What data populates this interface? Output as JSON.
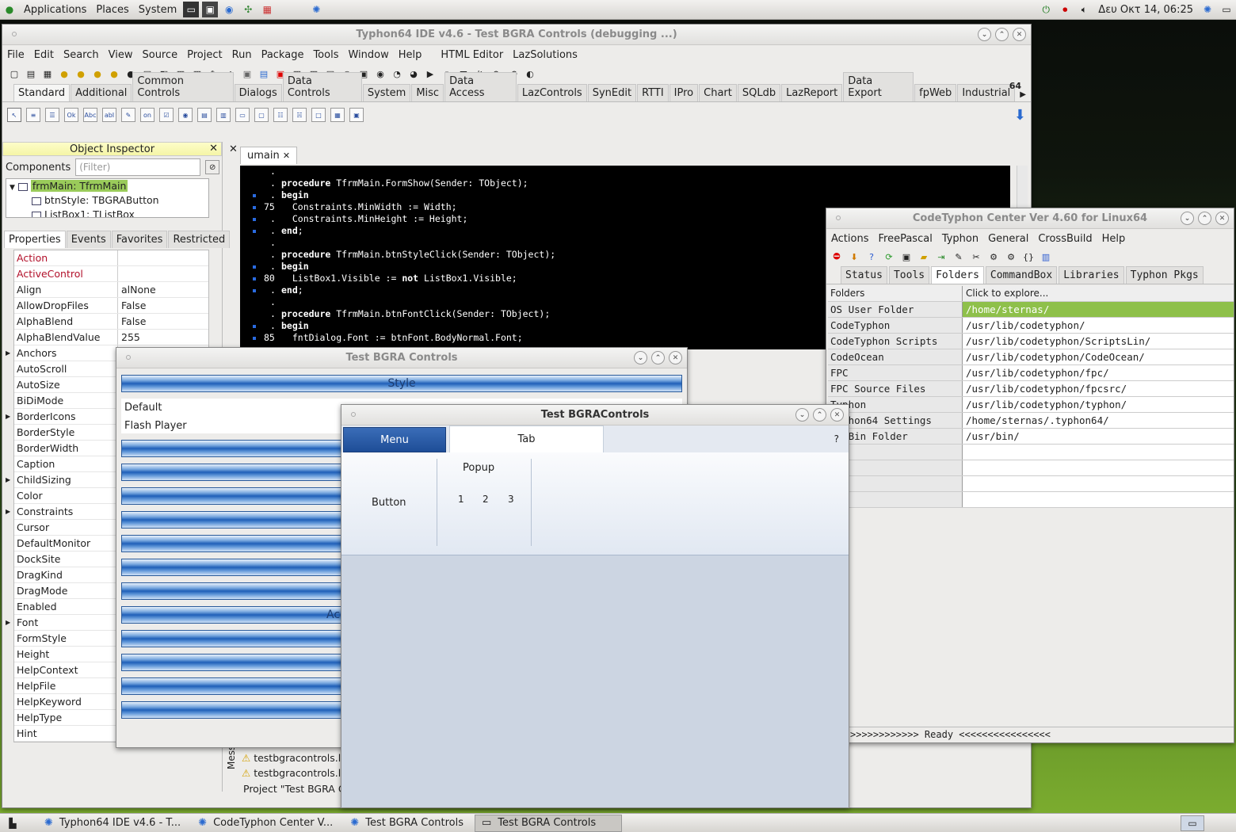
{
  "top_panel": {
    "menus": [
      "Applications",
      "Places",
      "System"
    ],
    "clock": "Δευ Οκτ 14, 06:25"
  },
  "ide": {
    "title": "Typhon64 IDE v4.6 - Test BGRA Controls (debugging ...)",
    "menu": [
      "File",
      "Edit",
      "Search",
      "View",
      "Source",
      "Project",
      "Run",
      "Package",
      "Tools",
      "Window",
      "Help",
      "HTML Editor",
      "LazSolutions"
    ],
    "palette_tabs": [
      "Standard",
      "Additional",
      "Common Controls",
      "Dialogs",
      "Data Controls",
      "System",
      "Misc",
      "Data Access",
      "LazControls",
      "SynEdit",
      "RTTI",
      "IPro",
      "Chart",
      "SQLdb",
      "LazReport",
      "Data Export",
      "fpWeb",
      "Industrial"
    ],
    "palette_number": "64",
    "palette_labels": {
      "ok": "Ok",
      "abc": "Abc",
      "abi": "abI",
      "on": "on"
    },
    "editor_tab": "umain",
    "code": [
      {
        "gut": ".",
        "num": "",
        "text": ""
      },
      {
        "gut": ".",
        "num": "",
        "text": "procedure TfrmMain.FormShow(Sender: TObject);"
      },
      {
        "gut": "•.",
        "num": "",
        "text": "begin"
      },
      {
        "gut": "•",
        "num": "75",
        "text": "  Constraints.MinWidth := Width;"
      },
      {
        "gut": "•.",
        "num": "",
        "text": "  Constraints.MinHeight := Height;"
      },
      {
        "gut": "•.",
        "num": "",
        "text": "end;"
      },
      {
        "gut": ".",
        "num": "",
        "text": ""
      },
      {
        "gut": ".",
        "num": "",
        "text": "procedure TfrmMain.btnStyleClick(Sender: TObject);"
      },
      {
        "gut": "•.",
        "num": "",
        "text": "begin"
      },
      {
        "gut": "•",
        "num": "80",
        "text": "  ListBox1.Visible := not ListBox1.Visible;"
      },
      {
        "gut": "•.",
        "num": "",
        "text": "end;"
      },
      {
        "gut": ".",
        "num": "",
        "text": ""
      },
      {
        "gut": ".",
        "num": "",
        "text": "procedure TfrmMain.btnFontClick(Sender: TObject);"
      },
      {
        "gut": "•.",
        "num": "",
        "text": "begin"
      },
      {
        "gut": "•",
        "num": "85",
        "text": "  fntDialog.Font := btnFont.BodyNormal.Font;"
      }
    ],
    "messages": [
      "testbgracontrols.l",
      "testbgracontrols.l",
      "Project \"Test BGRA C"
    ],
    "messages_label": "Messa"
  },
  "object_inspector": {
    "title": "Object Inspector",
    "components_label": "Components",
    "filter_placeholder": "(Filter)",
    "tree": [
      "frmMain: TfrmMain",
      "btnStyle: TBGRAButton",
      "ListBox1: TListBox"
    ],
    "tabs": [
      "Properties",
      "Events",
      "Favorites",
      "Restricted"
    ],
    "props": [
      {
        "n": "Action",
        "v": "",
        "red": true
      },
      {
        "n": "ActiveControl",
        "v": "",
        "red": true
      },
      {
        "n": "Align",
        "v": "alNone"
      },
      {
        "n": "AllowDropFiles",
        "v": "False"
      },
      {
        "n": "AlphaBlend",
        "v": "False"
      },
      {
        "n": "AlphaBlendValue",
        "v": "255"
      },
      {
        "n": "Anchors",
        "v": "",
        "exp": true
      },
      {
        "n": "AutoScroll",
        "v": ""
      },
      {
        "n": "AutoSize",
        "v": ""
      },
      {
        "n": "BiDiMode",
        "v": ""
      },
      {
        "n": "BorderIcons",
        "v": "",
        "exp": true
      },
      {
        "n": "BorderStyle",
        "v": ""
      },
      {
        "n": "BorderWidth",
        "v": ""
      },
      {
        "n": "Caption",
        "v": ""
      },
      {
        "n": "ChildSizing",
        "v": "",
        "exp": true
      },
      {
        "n": "Color",
        "v": ""
      },
      {
        "n": "Constraints",
        "v": "",
        "exp": true
      },
      {
        "n": "Cursor",
        "v": ""
      },
      {
        "n": "DefaultMonitor",
        "v": ""
      },
      {
        "n": "DockSite",
        "v": ""
      },
      {
        "n": "DragKind",
        "v": ""
      },
      {
        "n": "DragMode",
        "v": ""
      },
      {
        "n": "Enabled",
        "v": ""
      },
      {
        "n": "Font",
        "v": "",
        "exp": true
      },
      {
        "n": "FormStyle",
        "v": ""
      },
      {
        "n": "Height",
        "v": ""
      },
      {
        "n": "HelpContext",
        "v": ""
      },
      {
        "n": "HelpFile",
        "v": ""
      },
      {
        "n": "HelpKeyword",
        "v": ""
      },
      {
        "n": "HelpType",
        "v": ""
      },
      {
        "n": "Hint",
        "v": ""
      }
    ]
  },
  "codetyphon": {
    "title": "CodeTyphon Center Ver 4.60 for Linux64",
    "menu": [
      "Actions",
      "FreePascal",
      "Typhon",
      "General",
      "CrossBuild",
      "Help"
    ],
    "tabs": [
      "Status",
      "Tools",
      "Folders",
      "CommandBox",
      "Libraries",
      "Typhon Pkgs"
    ],
    "header": [
      "Folders",
      "Click to explore..."
    ],
    "rows": [
      [
        "OS User Folder",
        "/home/sternas/"
      ],
      [
        "CodeTyphon",
        "/usr/lib/codetyphon/"
      ],
      [
        "CodeTyphon Scripts",
        "/usr/lib/codetyphon/ScriptsLin/"
      ],
      [
        "CodeOcean",
        "/usr/lib/codetyphon/CodeOcean/"
      ],
      [
        "FPC",
        "/usr/lib/codetyphon/fpc/"
      ],
      [
        "FPC Source Files",
        "/usr/lib/codetyphon/fpcsrc/"
      ],
      [
        "Typhon",
        "/usr/lib/codetyphon/typhon/"
      ],
      [
        "Typhon64 Settings",
        "/home/sternas/.typhon64/"
      ],
      [
        "OS Bin Folder",
        "/usr/bin/"
      ]
    ],
    "status": ">>>>>>>>>>>> Ready <<<<<<<<<<<<<<<<"
  },
  "bgra_main": {
    "title": "Test BGRA Controls",
    "style_label": "Style",
    "list": [
      "Default",
      "Flash Player"
    ],
    "acc_label": "Acc"
  },
  "bgra_small": {
    "title": "Test BGRAControls",
    "menu": "Menu",
    "tab": "Tab",
    "help": "?",
    "button": "Button",
    "popup": "Popup",
    "nums": [
      "1",
      "2",
      "3"
    ]
  },
  "taskbar": [
    "Typhon64 IDE v4.6 - T...",
    "CodeTyphon Center V...",
    "Test BGRA Controls",
    "Test BGRA Controls"
  ]
}
